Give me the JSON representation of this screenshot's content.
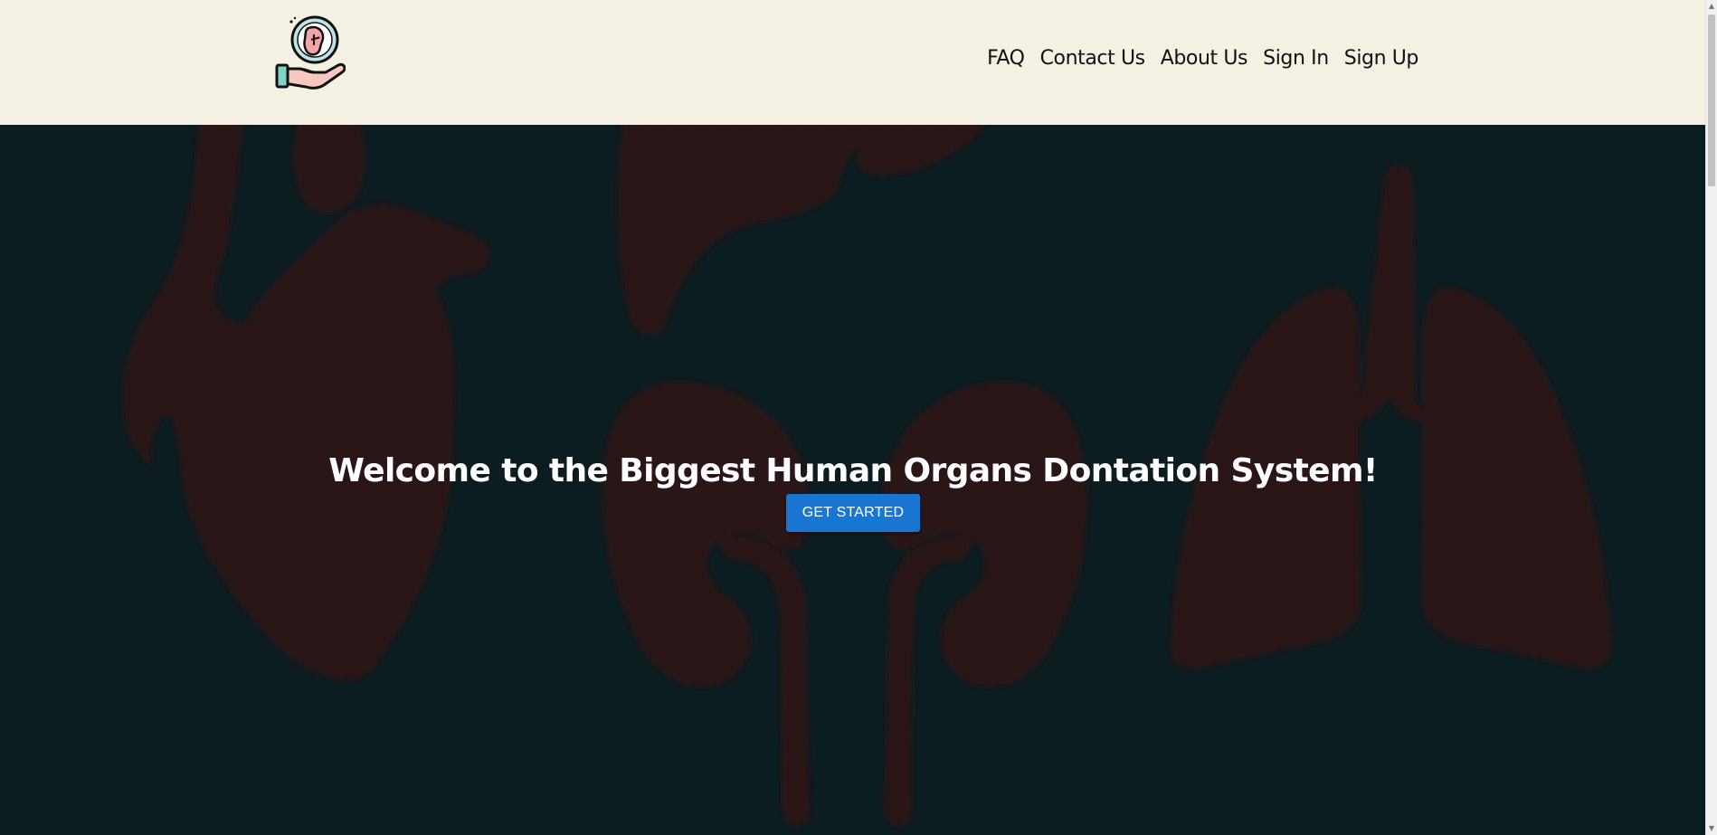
{
  "header": {
    "logo_icon": "organ-donation-hand-icon",
    "nav": {
      "faq": "FAQ",
      "contact": "Contact Us",
      "about": "About Us",
      "signin": "Sign In",
      "signup": "Sign Up"
    }
  },
  "hero": {
    "title": "Welcome to the Biggest Human Organs Dontation System!",
    "cta_label": "GET STARTED",
    "background_icons": [
      "heart-icon",
      "liver-icon",
      "kidneys-icon",
      "lungs-icon"
    ]
  },
  "colors": {
    "header_bg": "#f4f1e4",
    "hero_bg": "#0c1d21",
    "organ_color": "#2a1414",
    "cta_bg": "#1976d2"
  }
}
